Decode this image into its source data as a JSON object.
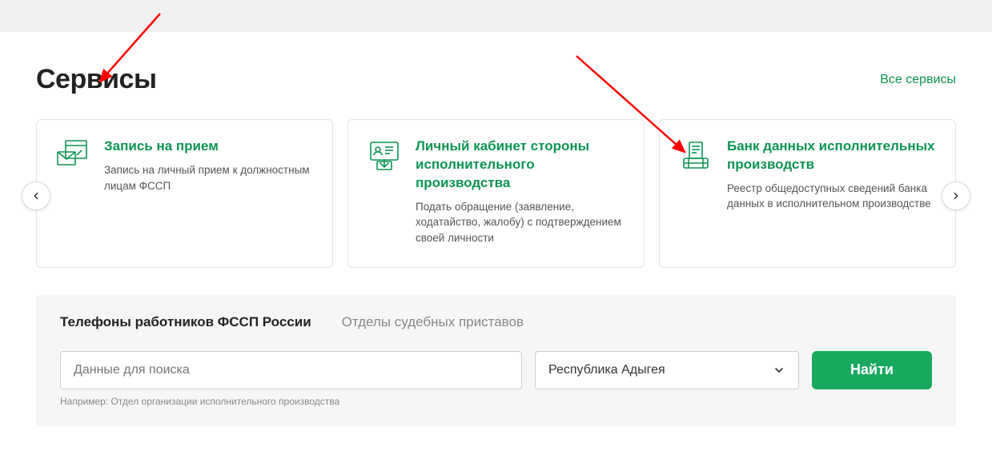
{
  "section": {
    "title": "Сервисы",
    "all_link": "Все сервисы"
  },
  "cards": [
    {
      "title": "Запись на прием",
      "desc": "Запись на личный прием к должностным лицам ФССП",
      "icon": "appointment-icon"
    },
    {
      "title": "Личный кабинет стороны исполнительного производства",
      "desc": "Подать обращение (заявление, ходатайство, жалобу) с подтверждением своей личности",
      "icon": "id-card-icon"
    },
    {
      "title": "Банк данных исполнительных производств",
      "desc": "Реестр общедоступных сведений банка данных в исполнительном производстве",
      "icon": "database-icon"
    }
  ],
  "nav": {
    "prev_label": "Previous",
    "next_label": "Next"
  },
  "search": {
    "tab_phones": "Телефоны работников ФССП России",
    "tab_departments": "Отделы судебных приставов",
    "input_placeholder": "Данные для поиска",
    "region_value": "Республика Адыгея",
    "button": "Найти",
    "hint": "Например: Отдел организации исполнительного производства"
  }
}
